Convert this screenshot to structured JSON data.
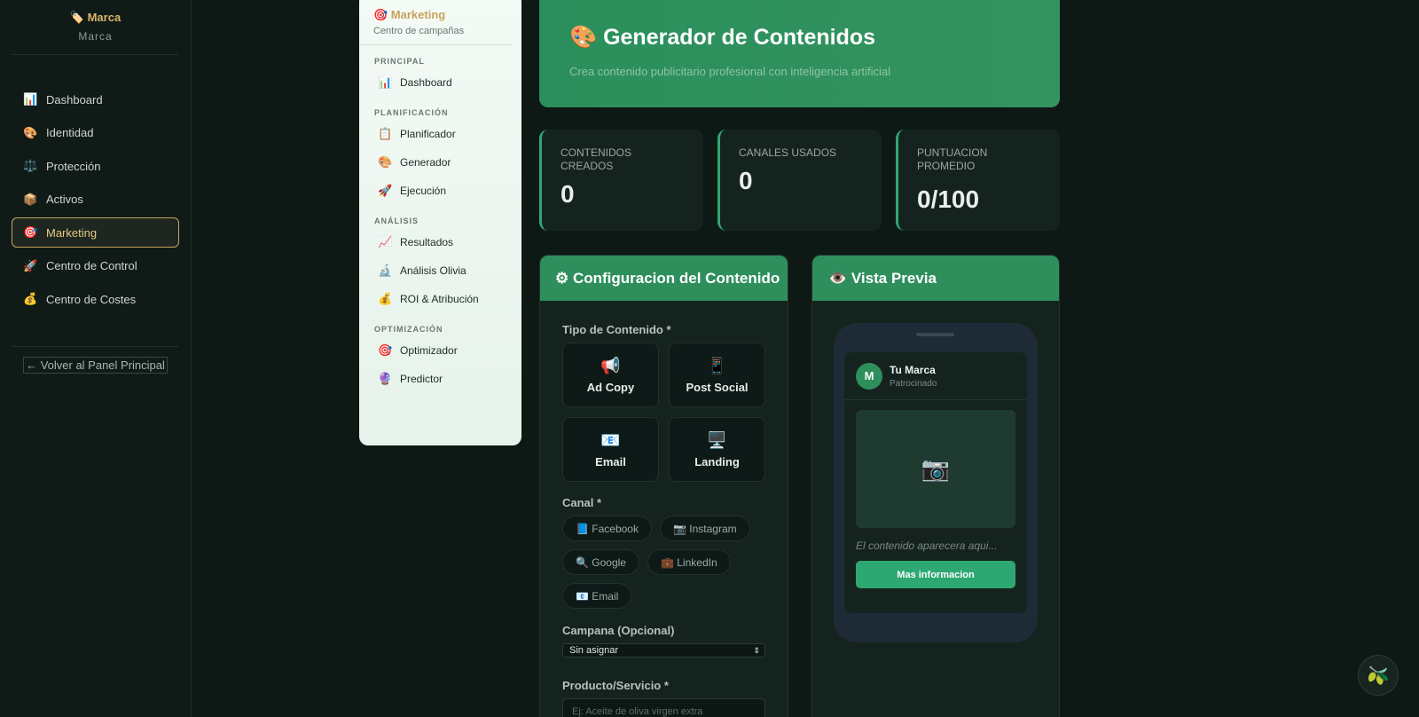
{
  "sidebar": {
    "brand_title": "🏷️ Marca",
    "brand_subtitle": "Marca",
    "items": [
      {
        "icon": "📊",
        "label": "Dashboard"
      },
      {
        "icon": "🎨",
        "label": "Identidad"
      },
      {
        "icon": "⚖️",
        "label": "Protección"
      },
      {
        "icon": "📦",
        "label": "Activos"
      },
      {
        "icon": "🎯",
        "label": "Marketing"
      },
      {
        "icon": "🚀",
        "label": "Centro de Control"
      },
      {
        "icon": "💰",
        "label": "Centro de Costes"
      }
    ],
    "back_link": "← Volver al Panel Principal"
  },
  "menu": {
    "title": "🎯 Marketing",
    "subtitle": "Centro de campañas",
    "sections": [
      {
        "label": "PRINCIPAL",
        "items": [
          {
            "icon": "📊",
            "label": "Dashboard"
          }
        ]
      },
      {
        "label": "PLANIFICACIÓN",
        "items": [
          {
            "icon": "📋",
            "label": "Planificador"
          },
          {
            "icon": "🎨",
            "label": "Generador"
          },
          {
            "icon": "🚀",
            "label": "Ejecución"
          }
        ]
      },
      {
        "label": "ANÁLISIS",
        "items": [
          {
            "icon": "📈",
            "label": "Resultados"
          },
          {
            "icon": "🔬",
            "label": "Análisis Olivia"
          },
          {
            "icon": "💰",
            "label": "ROI & Atribución"
          }
        ]
      },
      {
        "label": "OPTIMIZACIÓN",
        "items": [
          {
            "icon": "🎯",
            "label": "Optimizador"
          },
          {
            "icon": "🔮",
            "label": "Predictor"
          }
        ]
      }
    ]
  },
  "hero": {
    "title": "🎨 Generador de Contenidos",
    "subtitle": "Crea contenido publicitario profesional con inteligencia artificial"
  },
  "stats": [
    {
      "label": "CONTENIDOS CREADOS",
      "value": "0"
    },
    {
      "label": "CANALES USADOS",
      "value": "0"
    },
    {
      "label": "PUNTUACION PROMEDIO",
      "value": "0/100"
    }
  ],
  "config": {
    "title": "⚙ Configuracion del Contenido",
    "type_label": "Tipo de Contenido *",
    "types": [
      {
        "icon": "📢",
        "label": "Ad Copy"
      },
      {
        "icon": "📱",
        "label": "Post Social"
      },
      {
        "icon": "📧",
        "label": "Email"
      },
      {
        "icon": "🖥️",
        "label": "Landing"
      }
    ],
    "channel_label": "Canal *",
    "channels": [
      "📘 Facebook",
      "📷 Instagram",
      "🔍 Google",
      "💼 LinkedIn",
      "📧 Email"
    ],
    "campaign_label": "Campana (Opcional)",
    "campaign_value": "Sin asignar",
    "product_label": "Producto/Servicio *",
    "product_placeholder": "Ej: Aceite de oliva virgen extra"
  },
  "preview": {
    "title": "👁️ Vista Previa",
    "avatar_letter": "M",
    "brand_name": "Tu Marca",
    "sponsored": "Patrocinado",
    "image_icon": "📷",
    "placeholder_text": "El contenido aparecera aqui...",
    "cta": "Mas informacion"
  },
  "fab_icon": "🫒",
  "colors": {
    "accent_green": "#2e8f5c",
    "gold": "#c9a35d",
    "background": "#0e1916"
  }
}
